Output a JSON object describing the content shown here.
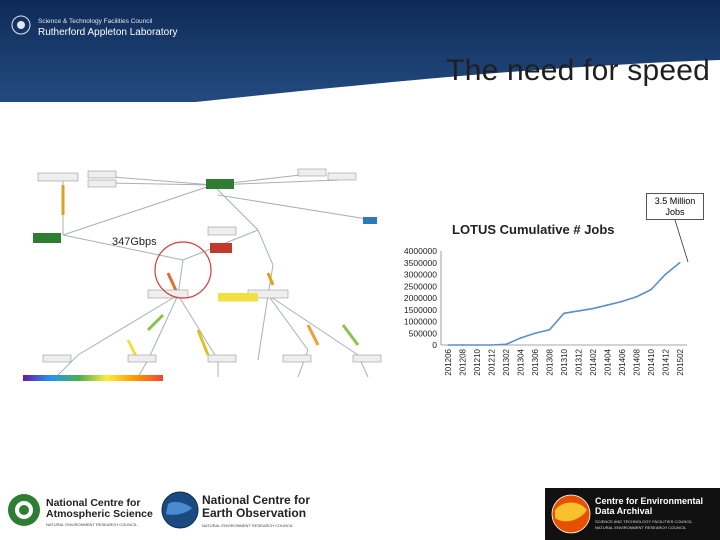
{
  "header": {
    "org_line1": "Science & Technology Facilities Council",
    "org_line2": "Rutherford Appleton Laboratory"
  },
  "page_title": "The need for speed",
  "network_label": "347Gbps",
  "callout": {
    "line1": "3.5 Million",
    "line2": "Jobs"
  },
  "chart_data": {
    "type": "line",
    "title": "LOTUS Cumulative # Jobs",
    "xlabel": "",
    "ylabel": "",
    "ylim": [
      0,
      4000000
    ],
    "yticks": [
      4000000,
      3500000,
      3000000,
      2500000,
      2000000,
      1500000,
      1000000,
      500000,
      0
    ],
    "categories": [
      "201206",
      "201208",
      "201210",
      "201212",
      "201302",
      "201304",
      "201306",
      "201308",
      "201310",
      "201312",
      "201402",
      "201404",
      "201406",
      "201408",
      "201410",
      "201412",
      "201502"
    ],
    "x": [
      "201206",
      "201208",
      "201210",
      "201212",
      "201302",
      "201304",
      "201306",
      "201308",
      "201310",
      "201312",
      "201402",
      "201404",
      "201406",
      "201408",
      "201410",
      "201412",
      "201502"
    ],
    "series": [
      {
        "values": [
          0,
          0,
          0,
          0,
          30000,
          300000,
          500000,
          650000,
          1350000,
          1450000,
          1550000,
          1700000,
          1850000,
          2050000,
          2350000,
          3000000,
          3500000
        ],
        "color": "#5b8ec8"
      }
    ],
    "grid": false
  },
  "footer": {
    "ncas_line1": "National Centre for",
    "ncas_line2": "Atmospheric Science",
    "ncas_line3": "NATURAL ENVIRONMENT RESEARCH COUNCIL",
    "nceo_line1": "National Centre for",
    "nceo_line2": "Earth Observation",
    "nceo_line3": "NATURAL ENVIRONMENT RESEARCH COUNCIL",
    "ceda_line1": "Centre for Environmental",
    "ceda_line2": "Data Archival",
    "ceda_line3": "SCIENCE AND TECHNOLOGY FACILITIES COUNCIL",
    "ceda_line4": "NATURAL ENVIRONMENT RESEARCH COUNCIL"
  },
  "colors": {
    "header_bg": "#1a3d6e",
    "line": "#5b8ec8",
    "ceda_bg": "#111111"
  }
}
